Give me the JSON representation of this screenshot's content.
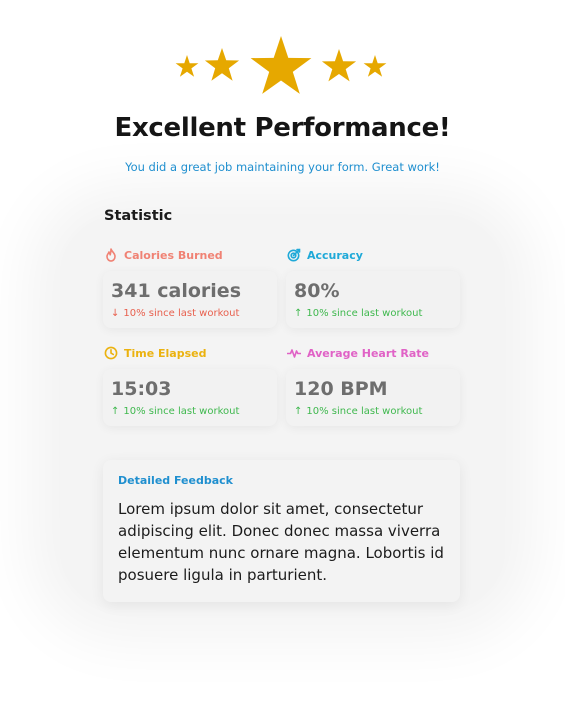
{
  "rating": {
    "filled": 5,
    "total": 5,
    "star_color": "#E6A800"
  },
  "header": {
    "title": "Excellent Performance!",
    "subtitle": "You did a great job maintaining your form. Great work!"
  },
  "statistics": {
    "heading": "Statistic",
    "items": [
      {
        "label": "Calories Burned",
        "icon": "flame-icon",
        "color": "#F08274",
        "value": "341 calories",
        "delta": "10% since last workout",
        "direction": "down",
        "delta_color": "#E8604E"
      },
      {
        "label": "Accuracy",
        "icon": "target-icon",
        "color": "#1FA9D8",
        "value": "80%",
        "delta": "10% since last workout",
        "direction": "up",
        "delta_color": "#3FB84E"
      },
      {
        "label": "Time Elapsed",
        "icon": "clock-icon",
        "color": "#EBB20F",
        "value": "15:03",
        "delta": "10% since last workout",
        "direction": "up",
        "delta_color": "#3FB84E"
      },
      {
        "label": "Average Heart Rate",
        "icon": "heartbeat-icon",
        "color": "#E062C6",
        "value": "120 BPM",
        "delta": "10% since last workout",
        "direction": "up",
        "delta_color": "#3FB84E"
      }
    ]
  },
  "feedback": {
    "label": "Detailed Feedback",
    "text": "Lorem ipsum dolor sit amet, consectetur adipiscing elit. Donec donec massa viverra elementum nunc ornare magna. Lobortis id posuere ligula in parturient."
  }
}
